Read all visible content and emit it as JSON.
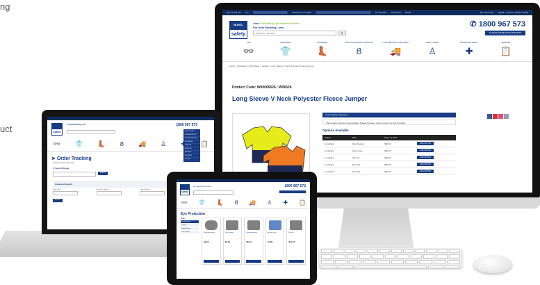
{
  "side_text": {
    "line1": "ng",
    "line2": "uct"
  },
  "site": {
    "topbar_items": [
      "0870 2 000 000",
      "ALL",
      "SEARCH IN STORE",
      "MY BASKET",
      "WISHLIST",
      "EMAIL"
    ],
    "topbar_right": [
      "MY ACCOUNT",
      "HOME - SAFETY WORK WEAR"
    ],
    "logo_top": "BUNZL",
    "logo_bottom": "safety",
    "tagline_prefix": "Your",
    "tagline_green": "Full Safety Specialist Provider",
    "tagline_line2": "For Safe Working Lives",
    "search_placeholder": "PRODUCT SEARCH",
    "phone": "1800 967 573",
    "access_button": "ACCESS INSPECTION REPORTS",
    "categories": [
      {
        "label": "PPE",
        "icon": "goggles-icon",
        "glyph": "👓"
      },
      {
        "label": "WORKWEAR",
        "icon": "tshirt-icon",
        "glyph": "👕"
      },
      {
        "label": "FOOTWEAR",
        "icon": "boot-icon",
        "glyph": "👢"
      },
      {
        "label": "LIFTING & MATERIALS HANDLING",
        "icon": "hook-icon",
        "glyph": "Ȣ"
      },
      {
        "label": "LOAD RESTRAINT / RECOVERY",
        "icon": "truck-icon",
        "glyph": "🚚"
      },
      {
        "label": "HEIGHT SAFETY",
        "icon": "harness-icon",
        "glyph": "♙"
      },
      {
        "label": "WORKPLACE SAFETY",
        "icon": "first-aid-icon",
        "glyph": "✚"
      },
      {
        "label": "SERVICES",
        "icon": "clipboard-icon",
        "glyph": "📋"
      }
    ],
    "breadcrumb": "Home > Workwear > Work Wear > Jackets > Long Sleeve V Neck Polyester Fleece Jumper",
    "product_code": "Product Code: W00006526 / W06526",
    "product_title": "Long Sleeve V Neck Polyester Fleece Jumper",
    "customisation_bar": "Customisation Required",
    "customisation_msg": "This product requires customisation. Please choose a colour & size from the list below.",
    "options_title": "Options Available",
    "table_headers": [
      "Colour",
      "Size",
      "Price ex GST",
      ""
    ],
    "rows": [
      {
        "colour": "Lime/Navy",
        "size": "Size Medium",
        "price": "$00.00",
        "btn": "ADD OPTION"
      },
      {
        "colour": "Lime/Navy",
        "size": "Size Large",
        "price": "$00.00",
        "btn": "ADD OPTION"
      },
      {
        "colour": "Lime/Navy",
        "size": "Size XL",
        "price": "$00.00",
        "btn": "ADD OPTION"
      },
      {
        "colour": "Lime/Navy",
        "size": "Size 2XL",
        "price": "$00.00",
        "btn": "ADD OPTION"
      },
      {
        "colour": "Lime/Navy",
        "size": "Size 3XL",
        "price": "$00.00",
        "btn": "ADD OPTION"
      }
    ],
    "share_colors": [
      "#3b5998",
      "#d9362b",
      "#e04b8c",
      "#9aa0a6"
    ]
  },
  "laptop": {
    "page_title": "Order Tracking",
    "subtitle": "Track the status of an order",
    "search_heading": "1. Search Range",
    "advanced_heading": "Advanced Search",
    "search_button": "SEARCH",
    "filter_labels": [
      "Order Status",
      "Purchase Order No.",
      "Order Reference",
      "Date Reference"
    ],
    "menu_items": [
      "MY ACCOUNT",
      "ORDER HISTORY",
      "ORDER TRACKING",
      "MY DETAILS",
      "WISHLIST",
      "INVOICES",
      "REPORTS",
      "SETTINGS",
      "LOGOUT"
    ]
  },
  "tablet": {
    "page_title": "Eye Protection",
    "sidebar_heading": "Filter",
    "sidebar_items": [
      "Eye Protection",
      "Goggles",
      "Safety Glasses",
      "Face Shields"
    ],
    "products": [
      "Safety Spectacles",
      "Clear Goggle",
      "Wraparound Lens",
      "Anti Fog Lens",
      "Visor Kit"
    ],
    "prices": [
      "$4.95",
      "$9.50",
      "$6.20",
      "$7.80",
      "$12.40"
    ]
  }
}
